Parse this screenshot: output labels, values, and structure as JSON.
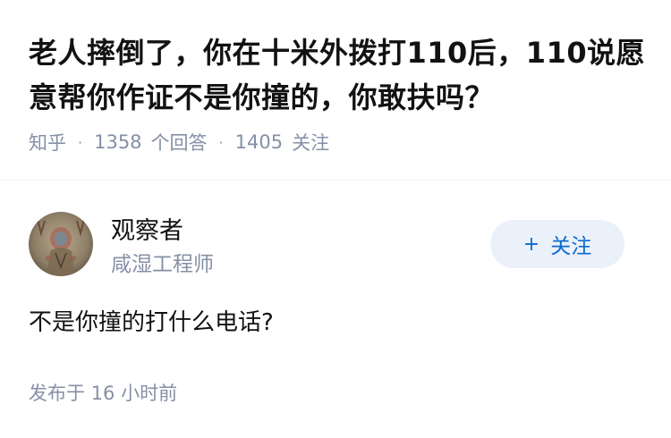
{
  "question": {
    "title": "老人摔倒了，你在十米外拨打110后，110说愿意帮你作证不是你撞的，你敢扶吗？",
    "source": "知乎",
    "separator": "·",
    "answer_count": "1358",
    "answer_label": "个回答",
    "follower_count": "1405",
    "follower_label": "关注"
  },
  "author": {
    "name": "观察者",
    "bio": "咸湿工程师",
    "avatar_icon": "avatar-portrait-icon"
  },
  "follow_button": {
    "icon": "plus-icon",
    "plus": "+",
    "label": "关注"
  },
  "answer": {
    "content": "不是你撞的打什么电话?"
  },
  "publish": {
    "label": "发布于",
    "time": "16 小时前"
  },
  "colors": {
    "text_primary": "#121212",
    "text_secondary": "#8590a6",
    "accent": "#0b6ad0",
    "button_bg": "#ebf1fa",
    "divider": "#f0f2f7"
  }
}
